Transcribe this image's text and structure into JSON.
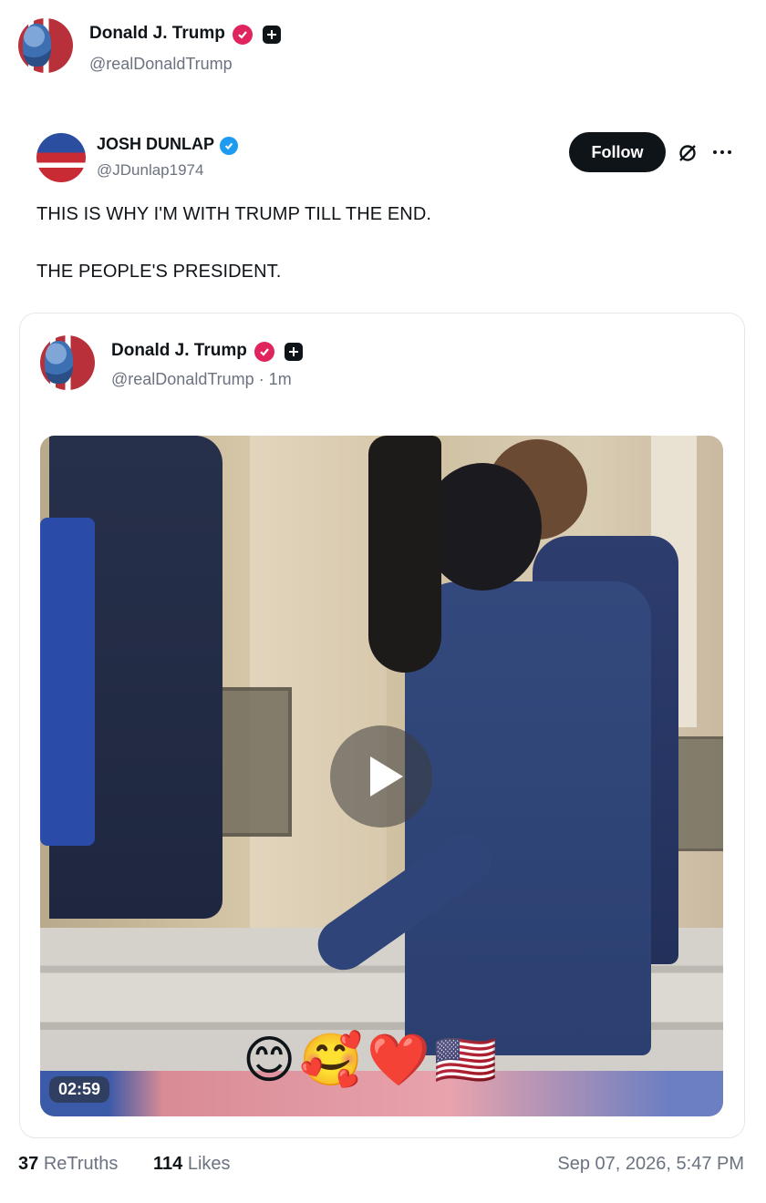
{
  "outer_post": {
    "author_name": "Donald J. Trump",
    "author_handle": "@realDonaldTrump"
  },
  "reposted": {
    "author_name": "JOSH DUNLAP",
    "author_handle": "@JDunlap1974",
    "follow_label": "Follow",
    "line1": "THIS IS WHY I'M WITH TRUMP TILL THE END.",
    "line2": "THE PEOPLE'S PRESIDENT."
  },
  "quoted": {
    "author_name": "Donald J. Trump",
    "author_handle": "@realDonaldTrump",
    "time_ago": "· 1m",
    "video_duration": "02:59",
    "emojis": "😊🥰❤️🇺🇸"
  },
  "footer": {
    "retruths_count": "37",
    "retruths_label": "ReTruths",
    "likes_count": "114",
    "likes_label": "Likes",
    "timestamp": "Sep 07, 2026, 5:47 PM"
  },
  "colors": {
    "verified_red": "#e0245e",
    "verified_blue": "#1d9bf0",
    "text_primary": "#0f1419",
    "text_secondary": "#6b7280"
  },
  "icons": [
    "verified-red-icon",
    "plus-badge-icon",
    "verified-blue-icon",
    "mute-icon",
    "more-icon",
    "play-icon"
  ]
}
